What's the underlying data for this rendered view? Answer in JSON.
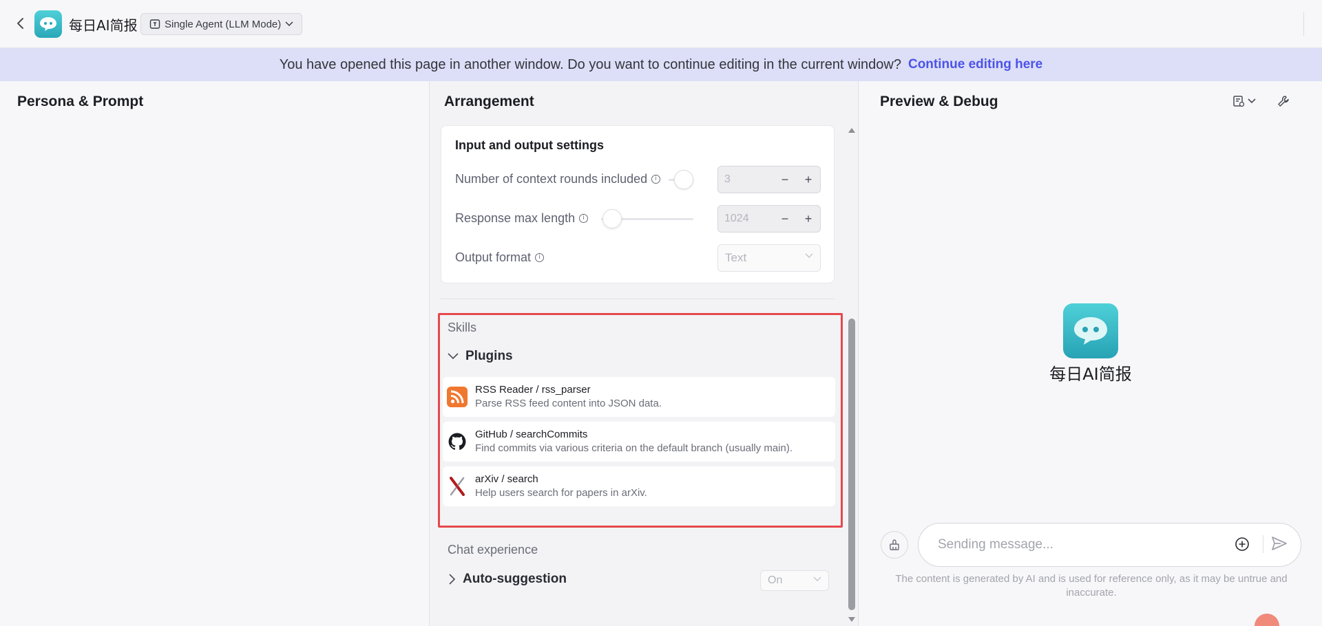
{
  "header": {
    "app_title": "每日AI简报",
    "mode_label": "Single Agent (LLM Mode)"
  },
  "banner": {
    "message": "You have opened this page in another window. Do you want to continue editing in the current window?",
    "link_label": "Continue editing here"
  },
  "left_panel": {
    "title": "Persona & Prompt"
  },
  "middle_panel": {
    "title": "Arrangement",
    "io_settings": {
      "title": "Input and output settings",
      "context_rounds": {
        "label": "Number of context rounds included",
        "value": "3"
      },
      "response_max_length": {
        "label": "Response max length",
        "value": "1024"
      },
      "output_format": {
        "label": "Output format",
        "value": "Text"
      }
    },
    "skills": {
      "label": "Skills",
      "plugins_label": "Plugins",
      "plugins": [
        {
          "name": "RSS Reader / rss_parser",
          "description": "Parse RSS feed content into JSON data.",
          "icon": "rss-icon"
        },
        {
          "name": "GitHub / searchCommits",
          "description": "Find commits via various criteria on the default branch (usually main).",
          "icon": "github-icon"
        },
        {
          "name": "arXiv / search",
          "description": "Help users search for papers in arXiv.",
          "icon": "arxiv-icon"
        }
      ]
    },
    "chat_experience": {
      "label": "Chat experience",
      "auto_suggestion_label": "Auto-suggestion",
      "auto_suggestion_value": "On"
    }
  },
  "right_panel": {
    "title": "Preview & Debug",
    "bot_name": "每日AI简报",
    "input_placeholder": "Sending message...",
    "disclaimer": "The content is generated by AI and is used for reference only, as it may be untrue and inaccurate."
  },
  "colors": {
    "accent": "#4d53e8",
    "banner_bg": "#dcdff7",
    "highlight_border": "#e5484d",
    "logo_gradient_top": "#4fd0d8",
    "logo_gradient_bottom": "#2ba8b8"
  }
}
